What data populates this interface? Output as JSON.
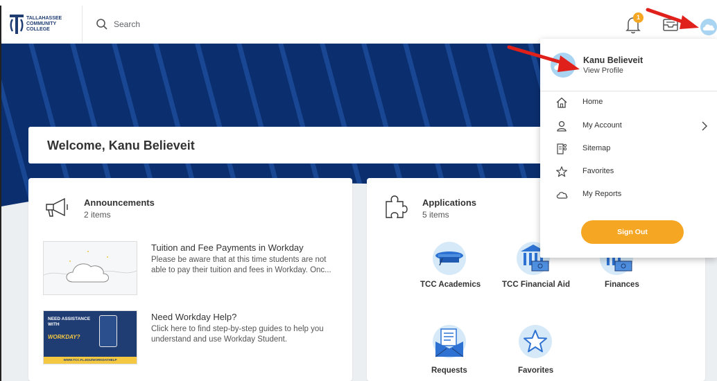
{
  "page": {
    "top_cropped_heading": ""
  },
  "header": {
    "logo_text_line1": "TALLAHASSEE",
    "logo_text_line2": "COMMUNITY",
    "logo_text_line3": "COLLEGE",
    "search_placeholder": "Search",
    "notification_count": "1",
    "icons": {
      "search": "search-icon",
      "bell": "bell-icon",
      "inbox": "inbox-icon",
      "avatar": "cloud-avatar-icon"
    }
  },
  "welcome": {
    "text": "Welcome, Kanu Believeit"
  },
  "announcements": {
    "title": "Announcements",
    "count": "2 items",
    "items": [
      {
        "title": "Tuition and Fee Payments in Workday",
        "desc_line1": "Please be aware that at this time students are not",
        "desc_line2": "able to pay their tuition and fees in Workday.  Onc..."
      },
      {
        "title": "Need Workday Help?",
        "desc_line1": "Click here to find step-by-step guides to help you",
        "desc_line2": "understand and use Workday Student.",
        "thumb_line1": "NEED ASSISTANCE",
        "thumb_line2": "WITH",
        "thumb_line3": "WORKDAY?",
        "thumb_url": "WWW.TCC.FL.EDU/WORKDAYHELP"
      }
    ]
  },
  "applications": {
    "title": "Applications",
    "count": "5 items",
    "tiles": [
      {
        "label": "TCC Academics",
        "icon": "graduation-cap-icon"
      },
      {
        "label": "TCC Financial Aid",
        "icon": "bank-money-icon"
      },
      {
        "label": "Finances",
        "icon": "bank-money-icon"
      },
      {
        "label": "Requests",
        "icon": "envelope-checklist-icon"
      },
      {
        "label": "Favorites",
        "icon": "star-icon"
      }
    ]
  },
  "profile_menu": {
    "name": "Kanu Believeit",
    "view_profile": "View Profile",
    "items": [
      {
        "label": "Home",
        "icon": "home-icon"
      },
      {
        "label": "My Account",
        "icon": "user-icon"
      },
      {
        "label": "Sitemap",
        "icon": "sitemap-icon"
      },
      {
        "label": "Favorites",
        "icon": "star-outline-icon"
      },
      {
        "label": "My Reports",
        "icon": "cloud-icon"
      }
    ],
    "sign_out": "Sign Out"
  },
  "colors": {
    "banner": "#0b2e6e",
    "accent_orange": "#f5a623",
    "avatar_blue": "#a9d4f2",
    "annotation_red": "#e0201b",
    "heading_blue": "#1a5fd1"
  }
}
